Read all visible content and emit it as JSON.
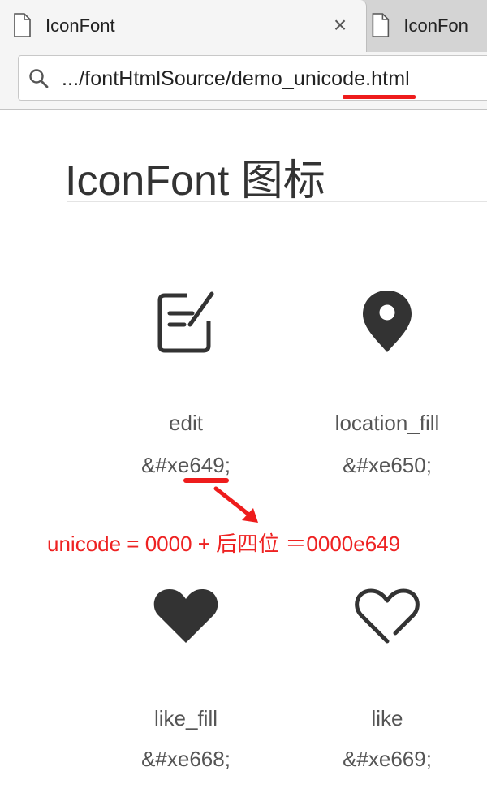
{
  "browser": {
    "active_tab": {
      "title": "IconFont",
      "close_symbol": "×"
    },
    "inactive_tab": {
      "title": "IconFon"
    },
    "address_bar": {
      "url": ".../fontHtmlSource/demo_unicode.html"
    },
    "icons": [
      "page-icon",
      "close-icon",
      "search-icon"
    ]
  },
  "page": {
    "title": "IconFont 图标",
    "icons": [
      {
        "name": "edit",
        "code": "&#xe649;",
        "glyph": "edit-icon"
      },
      {
        "name": "location_fill",
        "code": "&#xe650;",
        "glyph": "location-fill-icon"
      },
      {
        "name": "like_fill",
        "code": "&#xe668;",
        "glyph": "heart-fill-icon"
      },
      {
        "name": "like",
        "code": "&#xe669;",
        "glyph": "heart-outline-icon"
      }
    ],
    "annotation": {
      "text": "unicode = 0000 + 后四位 ＝0000e649",
      "color": "#ee2222"
    }
  },
  "colors": {
    "icon": "#333333",
    "text": "#555555",
    "accent": "#ee1c1c",
    "chrome": "#dfdfdf"
  }
}
